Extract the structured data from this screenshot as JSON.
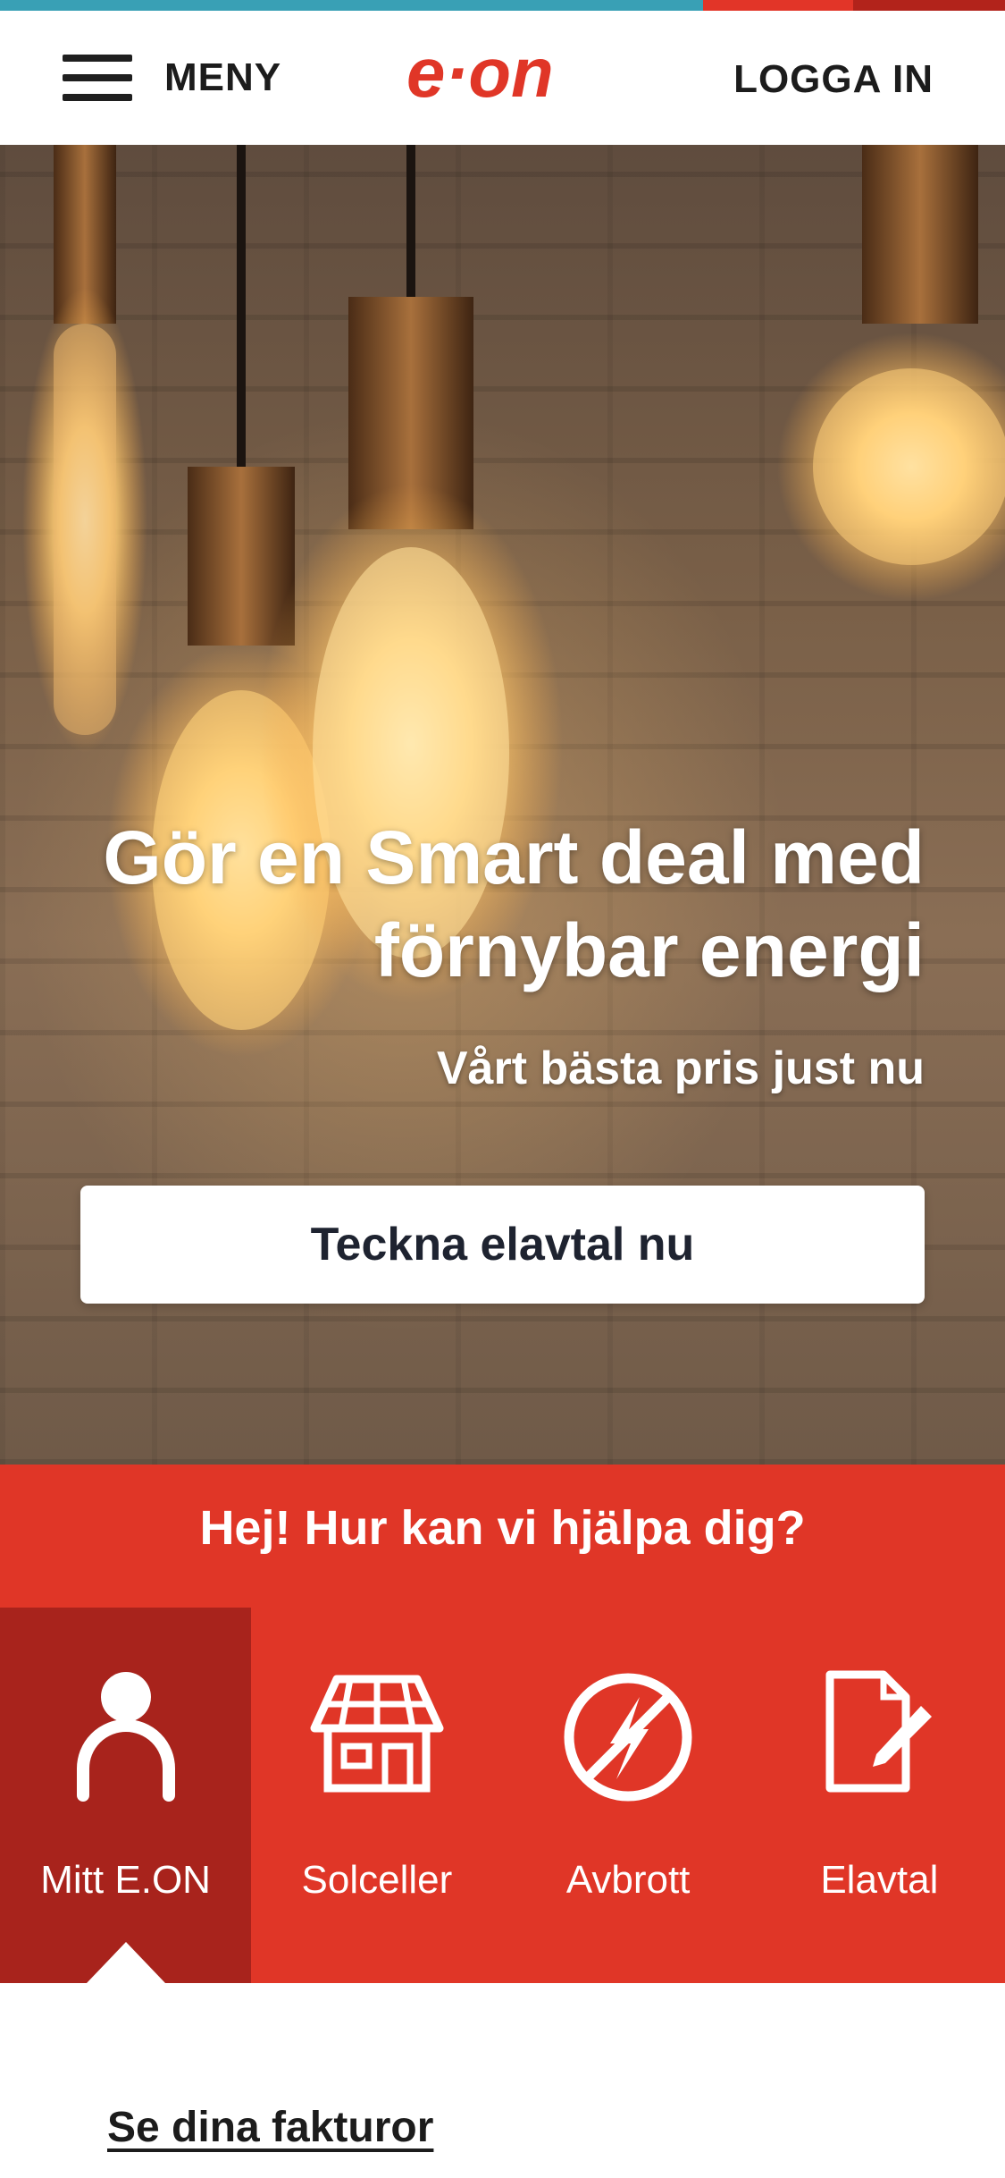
{
  "header": {
    "menu_label": "MENY",
    "brand": "e·on",
    "login_label": "LOGGA IN"
  },
  "hero": {
    "title": "Gör en Smart deal med förnybar energi",
    "subtitle": "Vårt bästa pris just nu",
    "cta_label": "Teckna elavtal nu"
  },
  "help": {
    "title": "Hej! Hur kan vi hjälpa dig?",
    "tiles": [
      {
        "label": "Mitt E.ON",
        "icon": "person-icon"
      },
      {
        "label": "Solceller",
        "icon": "solar-house-icon"
      },
      {
        "label": "Avbrott",
        "icon": "power-outage-icon"
      },
      {
        "label": "Elavtal",
        "icon": "contract-edit-icon"
      }
    ]
  },
  "links": {
    "invoices": "Se dina fakturor"
  },
  "colors": {
    "brand_red": "#e03627",
    "active_tile": "#a8231c",
    "stripe_teal": "#39a0b5"
  }
}
